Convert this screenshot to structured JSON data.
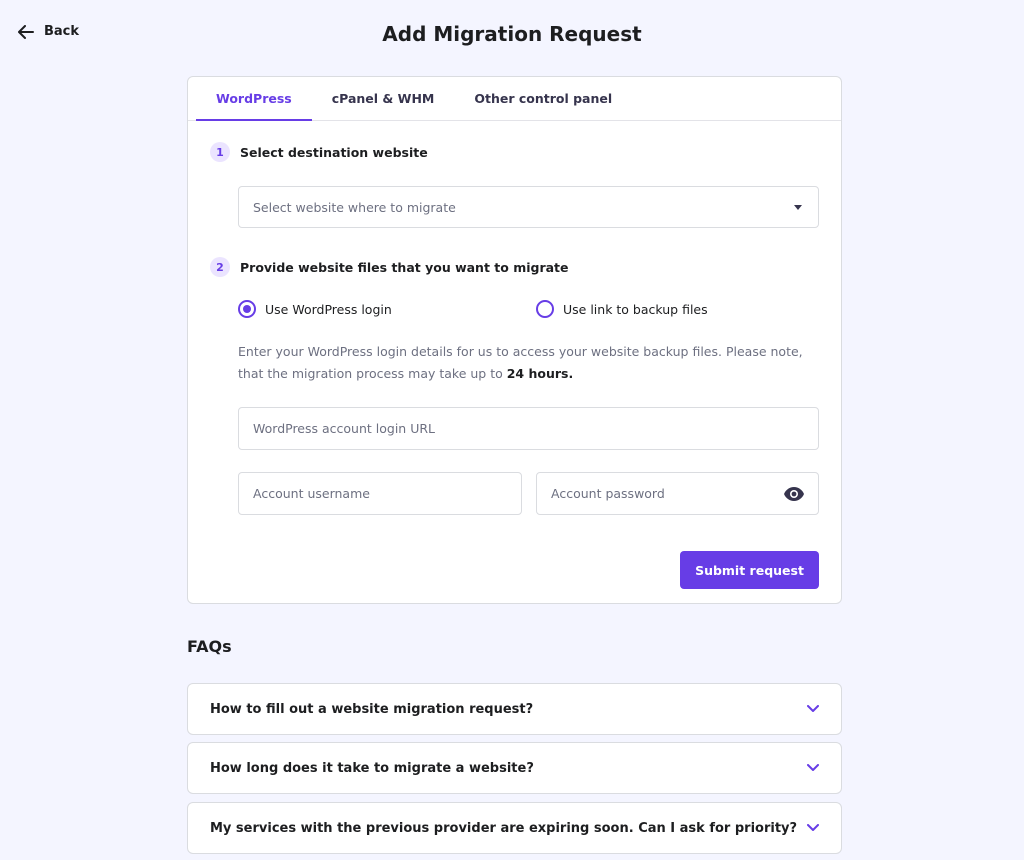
{
  "header": {
    "back_label": "Back",
    "title": "Add Migration Request"
  },
  "tabs": [
    {
      "label": "WordPress",
      "active": true
    },
    {
      "label": "cPanel & WHM",
      "active": false
    },
    {
      "label": "Other control panel",
      "active": false
    }
  ],
  "step1": {
    "number": "1",
    "label": "Select destination website",
    "select_placeholder": "Select website where to migrate"
  },
  "step2": {
    "number": "2",
    "label": "Provide website files that you want to migrate",
    "options": [
      {
        "label": "Use WordPress login",
        "selected": true
      },
      {
        "label": "Use link to backup files",
        "selected": false
      }
    ],
    "description": "Enter your WordPress login details for us to access your website backup files. Please note, that the migration process may take up to ",
    "description_bold": "24 hours.",
    "login_url_placeholder": "WordPress account login URL",
    "username_placeholder": "Account username",
    "password_placeholder": "Account password",
    "submit_label": "Submit request"
  },
  "faqs": {
    "heading": "FAQs",
    "items": [
      {
        "question": "How to fill out a website migration request?"
      },
      {
        "question": "How long does it take to migrate a website?"
      },
      {
        "question": "My services with the previous provider are expiring soon. Can I ask for priority?"
      }
    ]
  },
  "colors": {
    "accent": "#673de6",
    "background": "#f4f5ff",
    "text": "#1d1e20",
    "muted": "#6d7081"
  },
  "icons": {
    "back": "arrow-left-icon",
    "select": "caret-down-icon",
    "password": "eye-icon",
    "faq": "chevron-down-icon"
  }
}
